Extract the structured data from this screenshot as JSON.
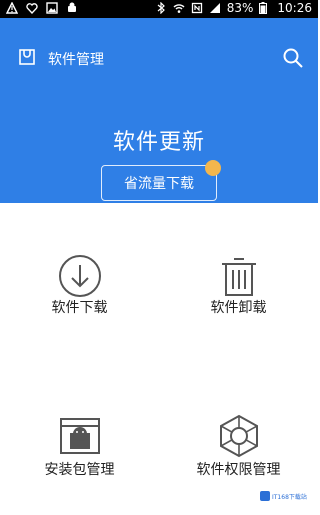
{
  "status_bar": {
    "battery": "83%",
    "time": "10:26"
  },
  "header": {
    "title": "软件管理",
    "main_title": "软件更新",
    "save_traffic_button": "省流量下载"
  },
  "grid": {
    "items": [
      {
        "label": "软件下载"
      },
      {
        "label": "软件卸载"
      },
      {
        "label": "安装包管理"
      },
      {
        "label": "软件权限管理"
      }
    ]
  },
  "watermark": {
    "text": "IT168下载站"
  },
  "colors": {
    "header_blue": "#2f7fe6",
    "badge_orange": "#f3b64d",
    "icon_gray": "#555555"
  }
}
